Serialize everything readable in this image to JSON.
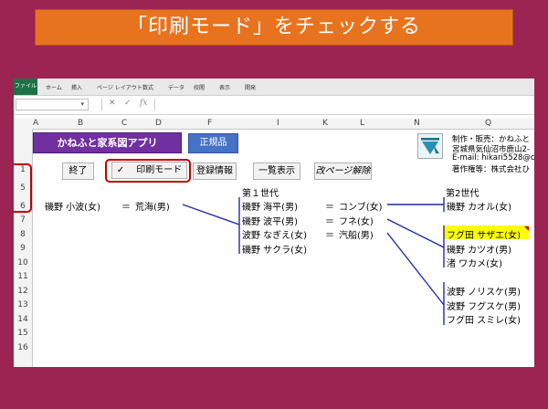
{
  "slide": {
    "title": "「印刷モード」をチェックする"
  },
  "ribbon": {
    "tabs": [
      "ファイル",
      "ホーム",
      "挿入",
      "ページ レイアウト",
      "数式",
      "データ",
      "校閲",
      "表示",
      "開発"
    ]
  },
  "formula_bar": {
    "cancel": "✕",
    "confirm": "✓",
    "fx": "fx"
  },
  "columns": [
    "A",
    "B",
    "C",
    "D",
    "F",
    "I",
    "K",
    "L",
    "N",
    "Q"
  ],
  "rows": [
    "1",
    "5",
    "6",
    "7",
    "8",
    "9",
    "10",
    "11",
    "12",
    "13",
    "14",
    "15",
    "16"
  ],
  "buttons": {
    "app": "かねふと家系図アプリ",
    "license": "正規品",
    "exit": "終了",
    "print_mode": "印刷モード",
    "print_mode_check": "✓",
    "registration": "登録情報",
    "list_view": "一覧表示",
    "page_break": "改ページ解除"
  },
  "producer": [
    "制作・販売：かねふと",
    "宮城県気仙沼市鹿山2-",
    "E-mail: hikari5528@c",
    "著作権等：株式会社ひ"
  ],
  "generations": {
    "first": "第１世代",
    "second": "第2世代"
  },
  "root": {
    "person": "磯野 小波(女)",
    "eq": "＝",
    "spouse": "荒海(男)"
  },
  "gen1": {
    "children": [
      "磯野 海平(男)",
      "磯野 波平(男)",
      "波野 なぎえ(女)",
      "磯野 サクラ(女)"
    ],
    "spouses": [
      {
        "eq": "＝",
        "name": "コンブ(女)"
      },
      {
        "eq": "＝",
        "name": "フネ(女)"
      },
      {
        "eq": "＝",
        "name": "汽船(男)"
      }
    ]
  },
  "gen2": {
    "row6": "磯野 カオル(女)",
    "row8": "フグ田 サザエ(女)",
    "row9": "磯野 カツオ(男)",
    "row10": "渚 ワカメ(女)",
    "row13": "波野 ノリスケ(男)",
    "row14": "波野 フグスケ(男)",
    "row15": "フグ田 スミレ(女)"
  },
  "colors": {
    "background": "#9b2452",
    "banner": "#e8731f",
    "app_button": "#7030a0",
    "license_button": "#4472c4",
    "highlight": "#c00000",
    "yellow": "#ffff00",
    "connector": "#1f2d9e"
  }
}
